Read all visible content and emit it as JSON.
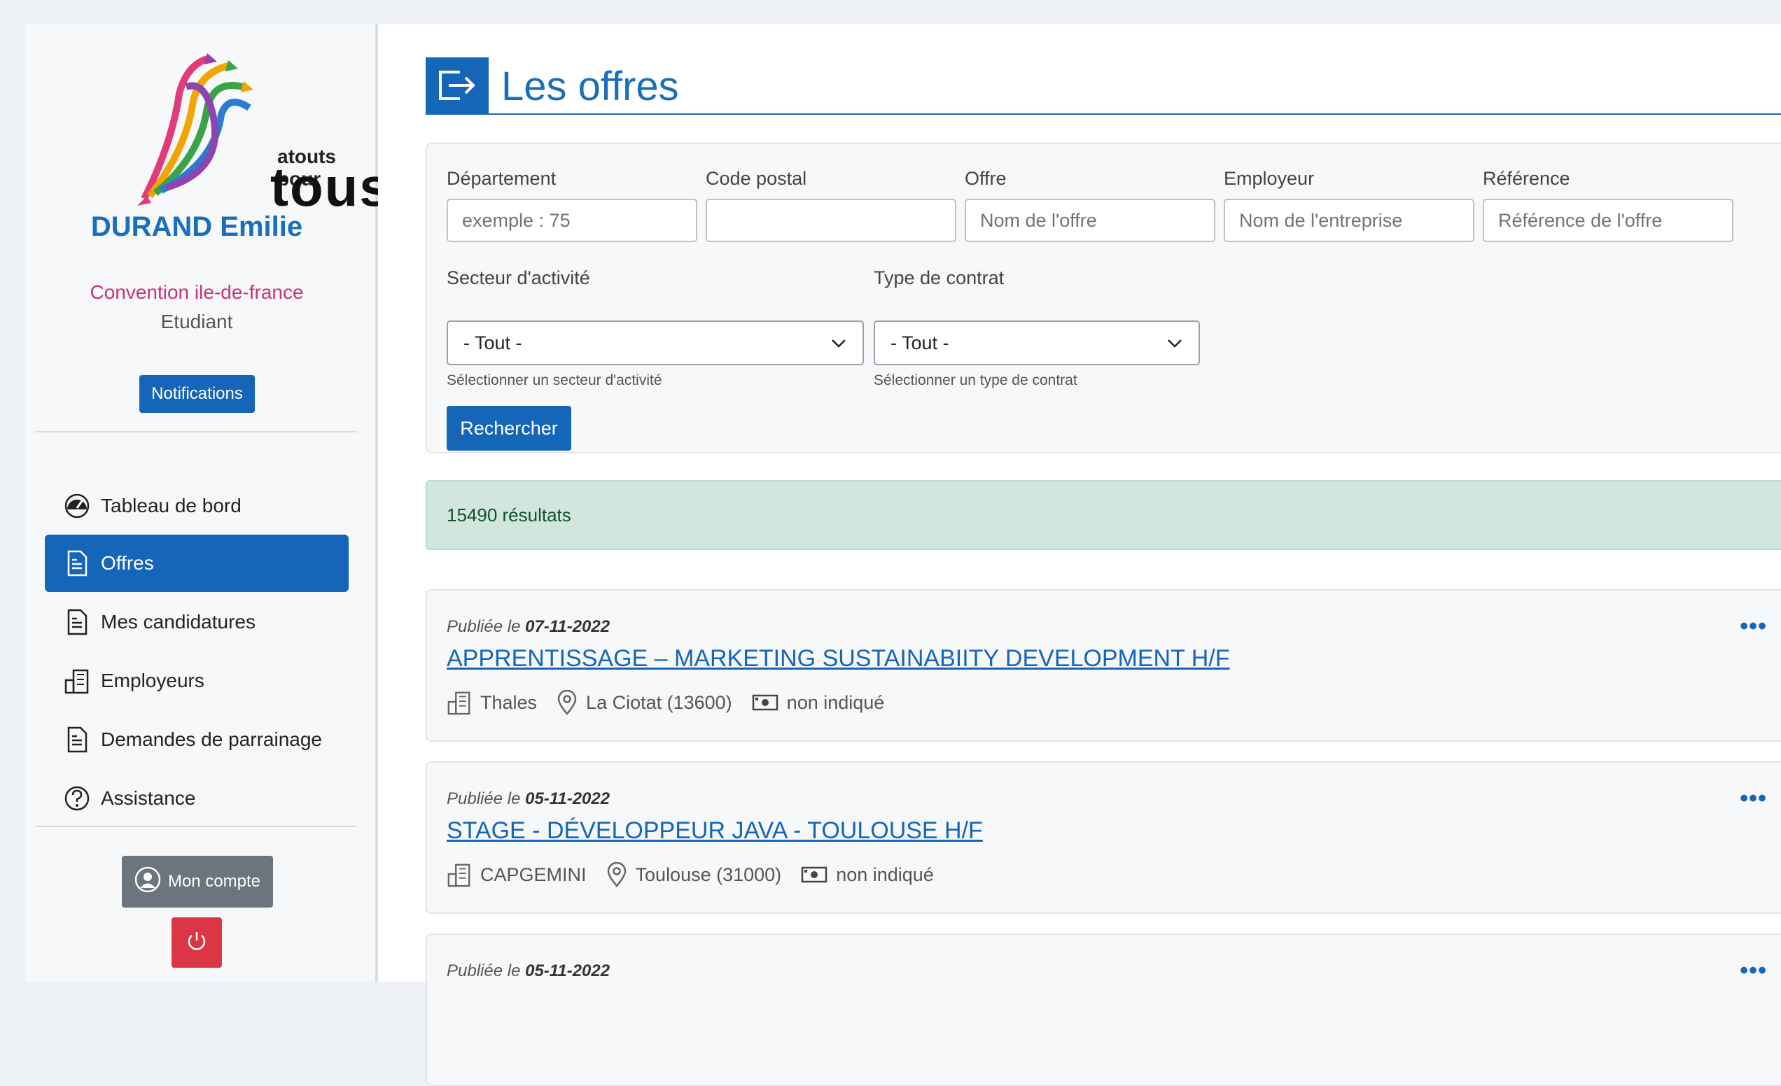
{
  "sidebar": {
    "logo": {
      "line1": "atouts pour",
      "line2": "tous"
    },
    "user_name": "DURAND Emilie",
    "convention": "Convention ile-de-france",
    "role": "Etudiant",
    "notifications_label": "Notifications",
    "items": [
      {
        "label": "Tableau de bord",
        "icon": "dashboard-icon"
      },
      {
        "label": "Offres",
        "icon": "document-icon",
        "active": true
      },
      {
        "label": "Mes candidatures",
        "icon": "document-icon"
      },
      {
        "label": "Employeurs",
        "icon": "building-icon"
      },
      {
        "label": "Demandes de parrainage",
        "icon": "document-icon"
      },
      {
        "label": "Assistance",
        "icon": "question-icon"
      }
    ],
    "account_label": "Mon compte"
  },
  "header": {
    "title": "Les offres"
  },
  "filters": {
    "departement": {
      "label": "Département",
      "placeholder": "exemple : 75",
      "value": ""
    },
    "code_postal": {
      "label": "Code postal",
      "placeholder": "",
      "value": ""
    },
    "offre": {
      "label": "Offre",
      "placeholder": "Nom de l'offre",
      "value": ""
    },
    "employeur": {
      "label": "Employeur",
      "placeholder": "Nom de l'entreprise",
      "value": ""
    },
    "reference": {
      "label": "Référence",
      "placeholder": "Référence de l'offre",
      "value": ""
    },
    "secteur": {
      "label": "Secteur d'activité",
      "selected": "- Tout -",
      "help": "Sélectionner un secteur d'activité"
    },
    "contrat": {
      "label": "Type de contrat",
      "selected": "- Tout -",
      "help": "Sélectionner un type de contrat"
    },
    "search_label": "Rechercher"
  },
  "results": {
    "text": "15490 résultats"
  },
  "offers": [
    {
      "published_prefix": "Publiée le",
      "date": "07-11-2022",
      "title": "APPRENTISSAGE – MARKETING SUSTAINABIITY DEVELOPMENT H/F",
      "employer": "Thales",
      "location": "La Ciotat (13600)",
      "salary": "non indiqué"
    },
    {
      "published_prefix": "Publiée le",
      "date": "05-11-2022",
      "title": "STAGE - DÉVELOPPEUR JAVA - TOULOUSE H/F",
      "employer": "CAPGEMINI",
      "location": "Toulouse (31000)",
      "salary": "non indiqué"
    },
    {
      "published_prefix": "Publiée le",
      "date": "05-11-2022"
    }
  ],
  "colors": {
    "primary": "#1565b8",
    "accent": "#c7327a",
    "danger": "#dc3545",
    "success_bg": "#d1e7dd"
  }
}
